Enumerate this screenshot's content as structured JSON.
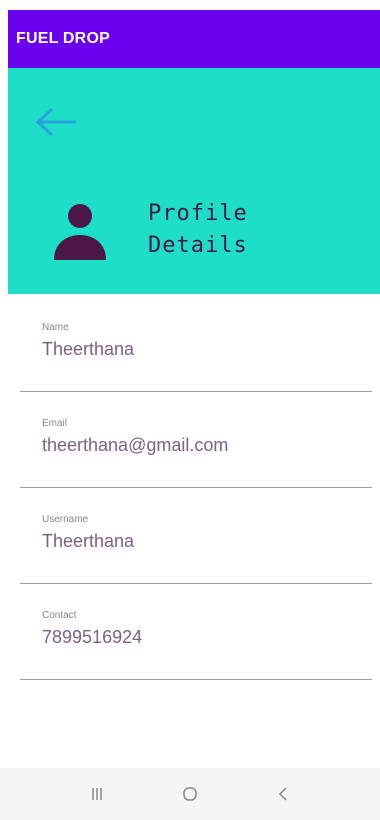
{
  "app_bar": {
    "title": "FUEL DROP",
    "color": "#6a00ee"
  },
  "header": {
    "background": "#1edec8",
    "back_icon": "arrow-left-icon",
    "avatar_icon": "person-icon",
    "title": "Profile\nDetails"
  },
  "fields": [
    {
      "label": "Name",
      "value": "Theerthana"
    },
    {
      "label": "Email",
      "value": "theerthana@gmail.com"
    },
    {
      "label": "Username",
      "value": "Theerthana"
    },
    {
      "label": "Contact",
      "value": "7899516924"
    }
  ],
  "system_nav": {
    "recents_icon": "recents-icon",
    "home_icon": "home-icon",
    "back_icon": "chevron-left-icon"
  }
}
